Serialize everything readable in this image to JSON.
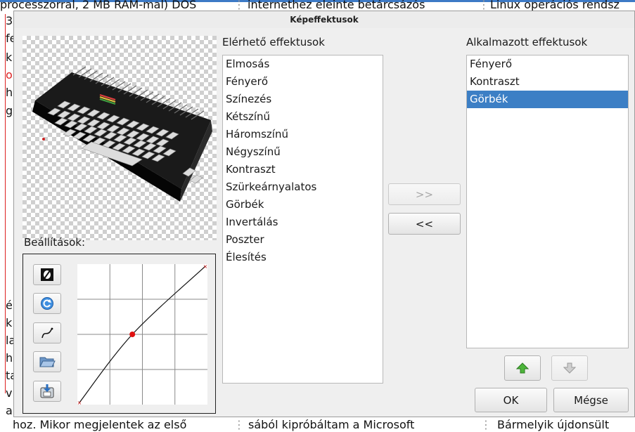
{
  "background": {
    "top_texts": [
      "processzorral, 2 MB RAM-mal) DOS",
      "internethez eleinte betárcsázós",
      "Linux operációs rendsz"
    ],
    "bottom_texts": [
      "hoz. Mikor megjelentek az első",
      "sából kipróbáltam a Microsoft",
      "Bármelyik újdonsült"
    ],
    "left_letters": [
      "3",
      "fe",
      "k",
      "o",
      "h",
      "g",
      "é",
      "k",
      "la",
      "h",
      "ta",
      "v",
      "a"
    ],
    "accent_color": "#3d7ac6"
  },
  "dialog": {
    "title": "Képeffektusok",
    "available_label": "Elérhető effektusok",
    "available_items": [
      "Elmosás",
      "Fényerő",
      "Színezés",
      "Kétszínű",
      "Háromszínű",
      "Négyszínű",
      "Kontraszt",
      "Szürkeárnyalatos",
      "Görbék",
      "Invertálás",
      "Poszter",
      "Élesítés"
    ],
    "applied_label": "Alkalmazott effektusok",
    "applied_items": [
      "Fényerő",
      "Kontraszt",
      "Görbék"
    ],
    "applied_selected": "Görbék",
    "add_button": ">>",
    "remove_button": "<<",
    "settings_label": "Beállítások:",
    "ok_button": "OK",
    "cancel_button": "Mégse",
    "selection_color": "#3c7fc5",
    "tool_icons": [
      "null-curve-icon",
      "reset-curve-icon",
      "smooth-curve-icon",
      "open-folder-icon",
      "save-icon"
    ],
    "move_up_icon": "arrow-up-icon",
    "move_down_icon": "arrow-down-icon"
  },
  "curve": {
    "x": [
      0,
      0.42,
      1
    ],
    "y": [
      0,
      0.5,
      1
    ],
    "selected_point_color": "#e01010"
  }
}
